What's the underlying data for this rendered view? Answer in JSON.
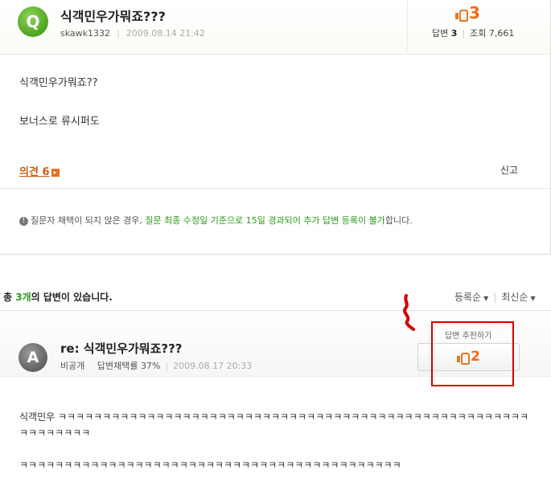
{
  "question": {
    "avatar_letter": "Q",
    "title": "식객민우가뭐죠???",
    "author": "skawk1332",
    "date": "2009.08.14 21:42",
    "likes": "3",
    "answers_label": "답변",
    "answers_count": "3",
    "views_label": "조회",
    "views_count": "7,661",
    "body": [
      "식객민우가뭐죠??",
      "보너스로 류시퍼도"
    ],
    "opinion_label": "의견",
    "opinion_count": "6",
    "report_label": "신고",
    "notice_prefix": "질문자 채택이 되지 않은 경우, ",
    "notice_highlight": "질문 최종 수정일 기준으로 15일 경과되어 추가 답변 등록이 불가",
    "notice_suffix": "합니다."
  },
  "answers_header": {
    "prefix": "총 ",
    "count": "3개",
    "suffix": "의 답변이 있습니다."
  },
  "sort": {
    "option1": "등록순",
    "option2": "최신순"
  },
  "answer": {
    "avatar_letter": "A",
    "title": "re: 식객민우가뭐죠???",
    "author": "비공개",
    "adoption_rate": "답변채택률 37%",
    "date": "2009.08.17 20:33",
    "recommend_label": "답변 추천하기",
    "recommend_count": "2",
    "body_line1": "식객민우 ㅋㅋㅋㅋㅋㅋㅋㅋㅋㅋㅋㅋㅋㅋㅋㅋㅋㅋㅋㅋㅋㅋㅋㅋㅋㅋㅋㅋㅋㅋㅋㅋㅋㅋㅋㅋㅋㅋㅋㅋㅋㅋㅋㅋㅋㅋㅋㅋㅋㅋㅋㅋㅋㅋㅋㅋㅋㅋㅋㅋㅋ",
    "body_line2": "ㅋㅋㅋㅋㅋㅋㅋㅋㅋㅋㅋㅋㅋㅋㅋㅋㅋㅋㅋㅋㅋㅋㅋㅋㅋㅋㅋㅋㅋㅋㅋㅋㅋㅋㅋㅋㅋㅋㅋㅋㅋㅋㅋ"
  },
  "colors": {
    "accent_orange": "#f06a1a",
    "accent_green": "#2d9a1c",
    "highlight_red": "#d30000"
  }
}
